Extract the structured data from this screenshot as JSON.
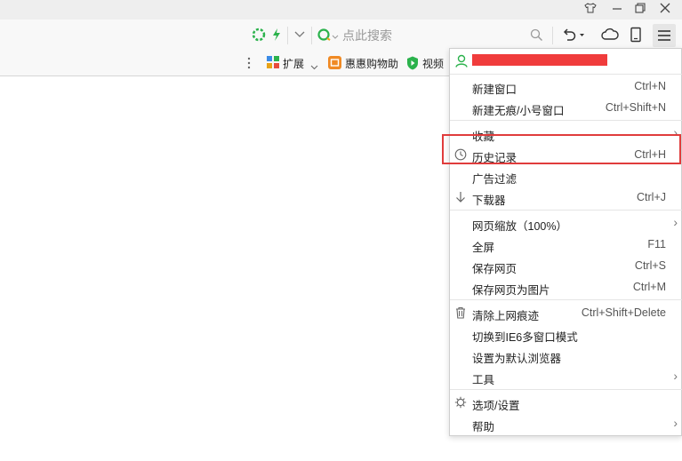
{
  "toolbar": {
    "search_placeholder": "点此搜索"
  },
  "bookmarks": [
    {
      "label": "扩展",
      "icon": "extensions-icon"
    },
    {
      "label": "惠惠购物助",
      "icon": "huihui-shopping-icon"
    },
    {
      "label": "视频",
      "icon": "video-shield-icon"
    }
  ],
  "menu": {
    "user_name_redacted_color": "#f03c3c",
    "items": [
      {
        "label": "新建窗口",
        "shortcut": "Ctrl+N"
      },
      {
        "label": "新建无痕/小号窗口",
        "shortcut": "Ctrl+Shift+N"
      },
      {
        "label": "收藏",
        "shortcut": ""
      },
      {
        "label": "历史记录",
        "shortcut": "Ctrl+H"
      },
      {
        "label": "广告过滤",
        "shortcut": ""
      },
      {
        "label": "下载器",
        "shortcut": "Ctrl+J"
      },
      {
        "label": "网页缩放（100%）",
        "shortcut": ""
      },
      {
        "label": "全屏",
        "shortcut": "F11"
      },
      {
        "label": "保存网页",
        "shortcut": "Ctrl+S"
      },
      {
        "label": "保存网页为图片",
        "shortcut": "Ctrl+M"
      },
      {
        "label": "清除上网痕迹",
        "shortcut": "Ctrl+Shift+Delete"
      },
      {
        "label": "切换到IE6多窗口模式",
        "shortcut": ""
      },
      {
        "label": "设置为默认浏览器",
        "shortcut": ""
      },
      {
        "label": "工具",
        "shortcut": ""
      },
      {
        "label": "选项/设置",
        "shortcut": ""
      },
      {
        "label": "帮助",
        "shortcut": ""
      }
    ]
  },
  "colors": {
    "highlight": "#e03c3c",
    "accent_green": "#2bb24c"
  }
}
